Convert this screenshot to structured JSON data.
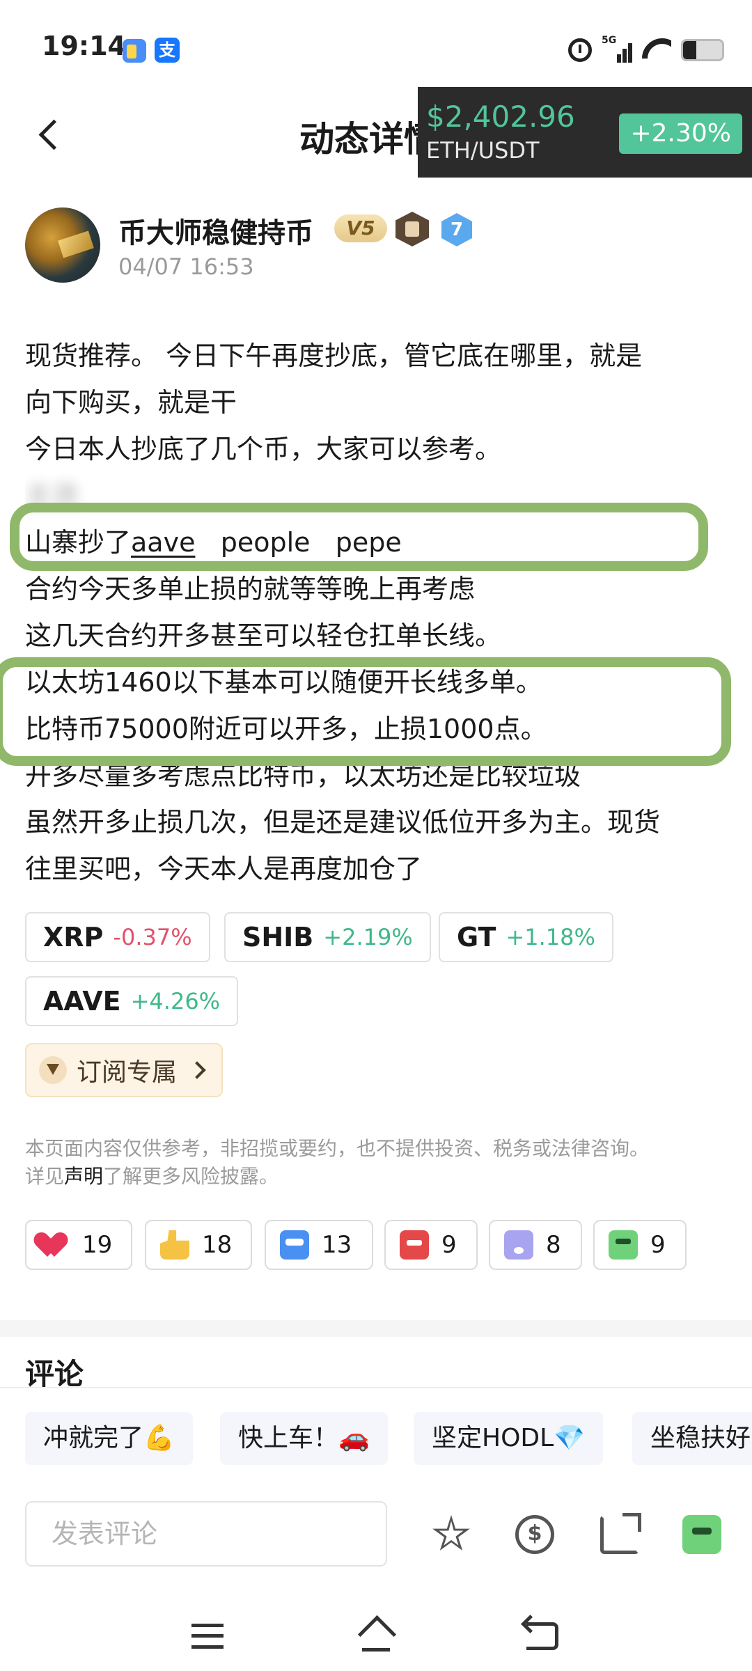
{
  "status_bar": {
    "time": "19:14",
    "network": "5G",
    "app_icon_2": "支"
  },
  "header": {
    "title": "动态详情"
  },
  "ticker": {
    "price": "$2,402.96",
    "pair": "ETH/USDT",
    "change": "+2.30%",
    "change_color": "#52c59a"
  },
  "author": {
    "name": "币大师稳健持币",
    "vip": "V5",
    "level": "7",
    "time": "04/07 16:53"
  },
  "post": {
    "lines": [
      "现货推荐。 今日下午再度抄底，管它底在哪里，就是",
      "向下购买，就是干",
      "今日本人抄底了几个币，大家可以参考。",
      "主流",
      "山寨抄了",
      "合约今天多单止损的就等等晚上再考虑",
      "这几天合约开多甚至可以轻仓扛单长线。",
      "以太坊1460以下基本可以随便开长线多单。",
      "比特币75000附近可以开多，止损1000点。",
      "开多尽量多考虑点比特币，以太坊还是比较垃圾",
      "虽然开多止损几次，但是还是建议低位开多为主。现货",
      "往里买吧，今天本人是再度加仓了"
    ],
    "altcoins": {
      "aave": "aave",
      "people": "people",
      "pepe": "pepe"
    },
    "highlight_color": "#8fb86a"
  },
  "coins": [
    {
      "symbol": "XRP",
      "change": "-0.37%",
      "direction": "down"
    },
    {
      "symbol": "SHIB",
      "change": "+2.19%",
      "direction": "up"
    },
    {
      "symbol": "GT",
      "change": "+1.18%",
      "direction": "up"
    },
    {
      "symbol": "AAVE",
      "change": "+4.26%",
      "direction": "up"
    }
  ],
  "subscribe": {
    "label": "订阅专属"
  },
  "disclaimer": {
    "line1": "本页面内容仅供参考，非招揽或要约，也不提供投资、税务或法律咨询。",
    "prefix": "详见",
    "link": "声明",
    "suffix": "了解更多风险披露。"
  },
  "reactions": [
    {
      "icon": "heart-icon",
      "count": "19"
    },
    {
      "icon": "thumbs-up-icon",
      "count": "18"
    },
    {
      "icon": "hodl-icon",
      "count": "13"
    },
    {
      "icon": "angry-icon",
      "count": "9"
    },
    {
      "icon": "shocked-icon",
      "count": "8"
    },
    {
      "icon": "sick-icon",
      "count": "9"
    }
  ],
  "comments": {
    "title": "评论"
  },
  "quick_replies": [
    "冲就完了💪",
    "快上车！🚗",
    "坚定HODL💎",
    "坐稳扶好"
  ],
  "comment_box": {
    "placeholder": "发表评论"
  },
  "colors": {
    "up": "#3fb88a",
    "down": "#e0526b"
  }
}
